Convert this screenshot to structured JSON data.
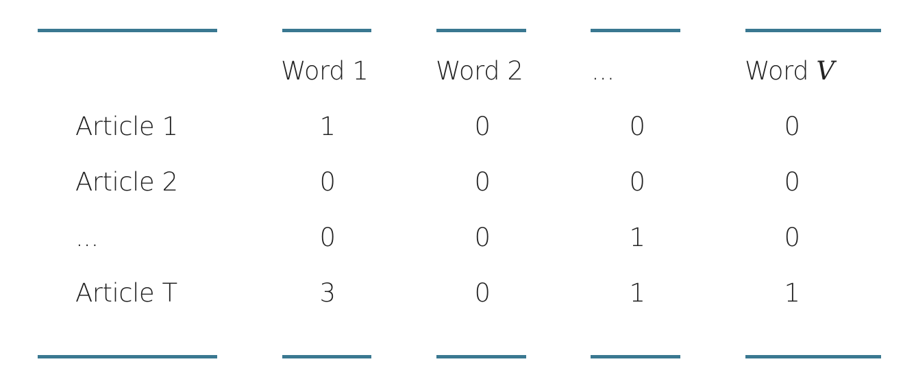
{
  "table": {
    "header": {
      "col1": "Word 1",
      "col2": "Word 2",
      "col3": "...",
      "col4_prefix": "Word",
      "col4_var": "V"
    },
    "rows": [
      {
        "label": "Article 1",
        "values": [
          "1",
          "0",
          "0",
          "0"
        ]
      },
      {
        "label": "Article 2",
        "values": [
          "0",
          "0",
          "0",
          "0"
        ]
      },
      {
        "label": "...",
        "values": [
          "0",
          "0",
          "1",
          "0"
        ]
      },
      {
        "label": "Article T",
        "values": [
          "3",
          "0",
          "1",
          "1"
        ]
      }
    ]
  },
  "colors": {
    "rule": "#3a7891",
    "text": "#222222"
  }
}
